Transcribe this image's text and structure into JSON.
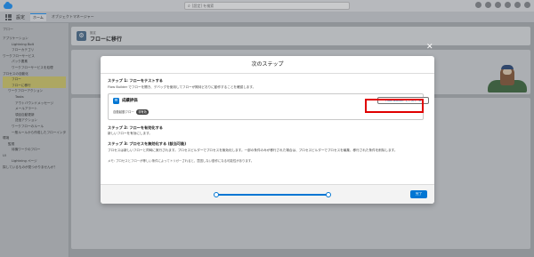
{
  "topbar": {
    "search_placeholder": "[設定] を検索"
  },
  "navbar": {
    "app_name": "設定",
    "tab_home": "ホーム",
    "tab_object": "オブジェクトマネージャー"
  },
  "sidebar": {
    "search": "フロー",
    "items": [
      "アプリケーション",
      "Lightning Bolt",
      "フローカテゴリ",
      "ワークフローサービス",
      "パック要素",
      "ワークフローサービスを処理",
      "プロセスの自動化",
      "フロー",
      "フローに移行",
      "ワークフローアクション",
      "Tasks",
      "アウトバウンドメッセージ",
      "メールアラート",
      "項目自動更新",
      "送信アクション",
      "ワークフローのルール",
      "一般ルールから作成したフローインタビュー",
      "環境",
      "監視",
      "待機ワークのフロー",
      "UI",
      "Lightning ページ"
    ],
    "footer": "探しているものが見つかりませんか？"
  },
  "header": {
    "subtitle": "設定",
    "title": "フローに移行"
  },
  "modal": {
    "title": "次のステップ",
    "step1_title": "ステップ 1: フローをテストする",
    "step1_desc": "Flow Builder でフローを開き、デバッグを使用してフローが期待どおりに動作することを確認します。",
    "flow_name": "成績評価",
    "flow_type": "自動起動フロー",
    "flow_badge": "非有効",
    "test_button": "Flow Builder でテスト",
    "step2_title": "ステップ 2: フローを有効化する",
    "step2_desc": "新しいフローを有効にします。",
    "step3_title": "ステップ 3: プロセスを無効化する (該当可能)",
    "step3_desc": "プロセスは新しいフローと同時に実行されます。プロセスビルダーでプロセスを無効化します。一部の条件のみが移行された場合は、プロセスビルダーでプロセスを編集、移行された条件を削除します。",
    "note": "メモ: プロセスとフローが等しい条件によってトリガーされると、意図しない動作になる可能性があります。",
    "done_button": "完了"
  },
  "colors": {
    "accent": "#0176d3",
    "highlight": "#e00000"
  }
}
